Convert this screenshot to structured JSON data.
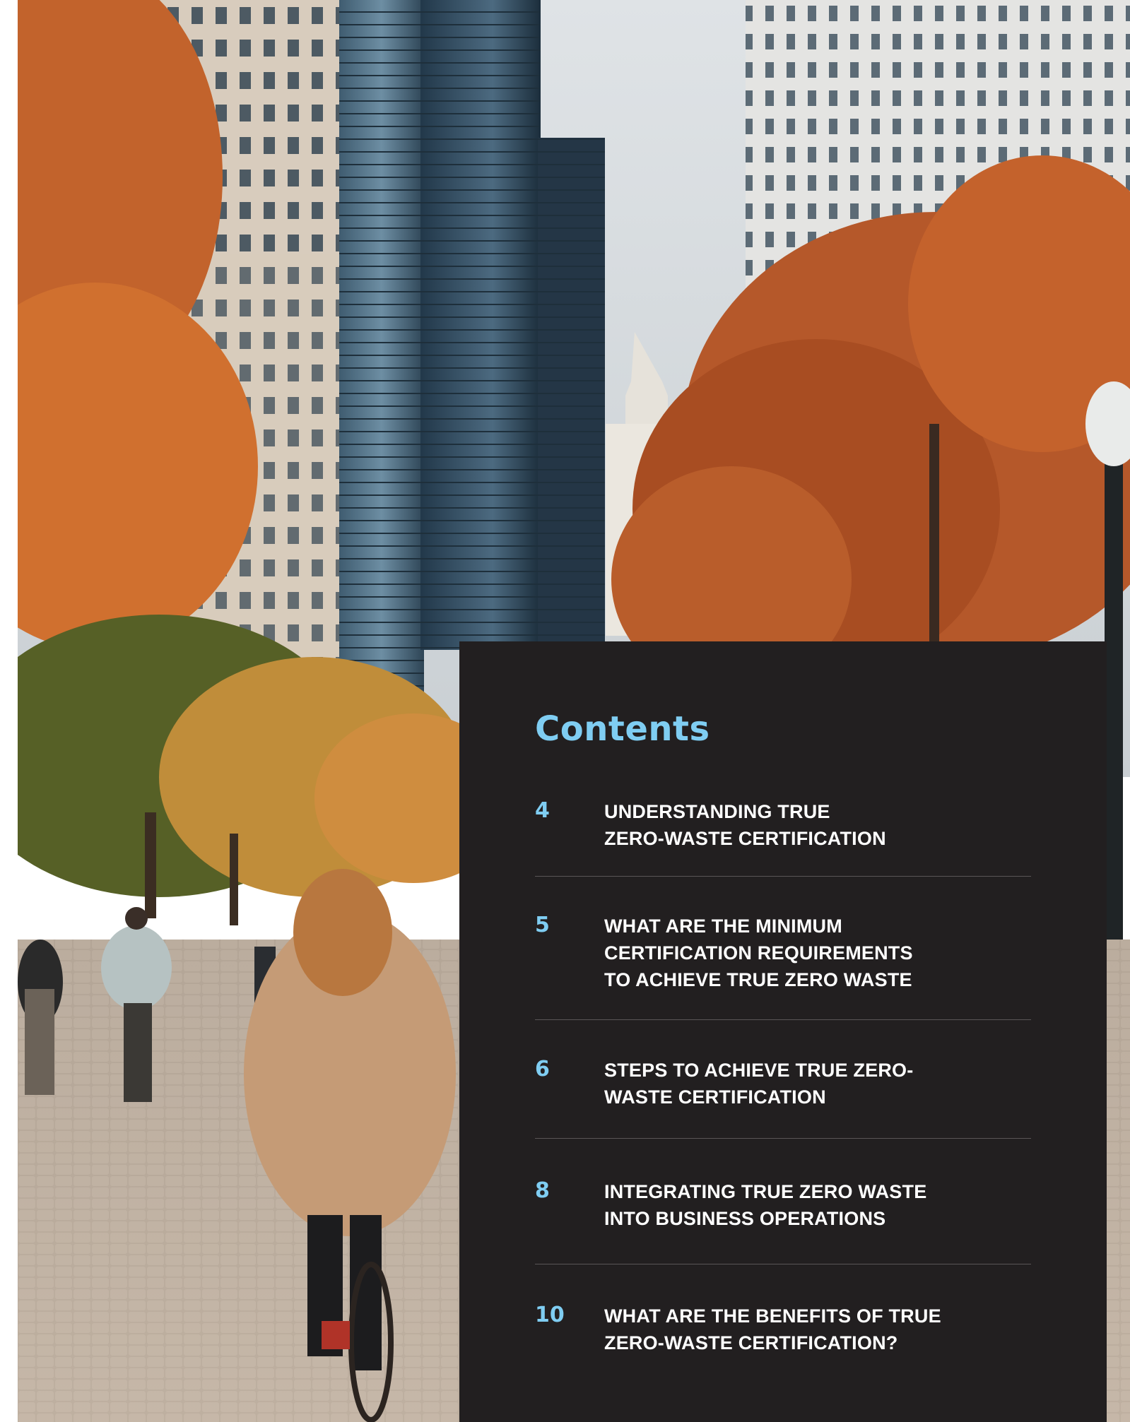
{
  "photo": {
    "icon": "city-street-autumn-photo"
  },
  "contents": {
    "title": "Contents",
    "items": [
      {
        "page": "4",
        "title": "UNDERSTANDING TRUE\nZERO-WASTE CERTIFICATION"
      },
      {
        "page": "5",
        "title": "WHAT ARE THE MINIMUM\nCERTIFICATION REQUIREMENTS\nTO ACHIEVE TRUE ZERO WASTE"
      },
      {
        "page": "6",
        "title": "STEPS TO ACHIEVE TRUE ZERO-\nWASTE CERTIFICATION"
      },
      {
        "page": "8",
        "title": "INTEGRATING TRUE ZERO WASTE\nINTO BUSINESS OPERATIONS"
      },
      {
        "page": "10",
        "title": "WHAT ARE THE BENEFITS OF TRUE\nZERO-WASTE CERTIFICATION?"
      }
    ]
  },
  "colors": {
    "panel_background": "#221f20",
    "accent": "#7fcdf2",
    "text": "#ffffff",
    "divider": "#5a5657"
  }
}
